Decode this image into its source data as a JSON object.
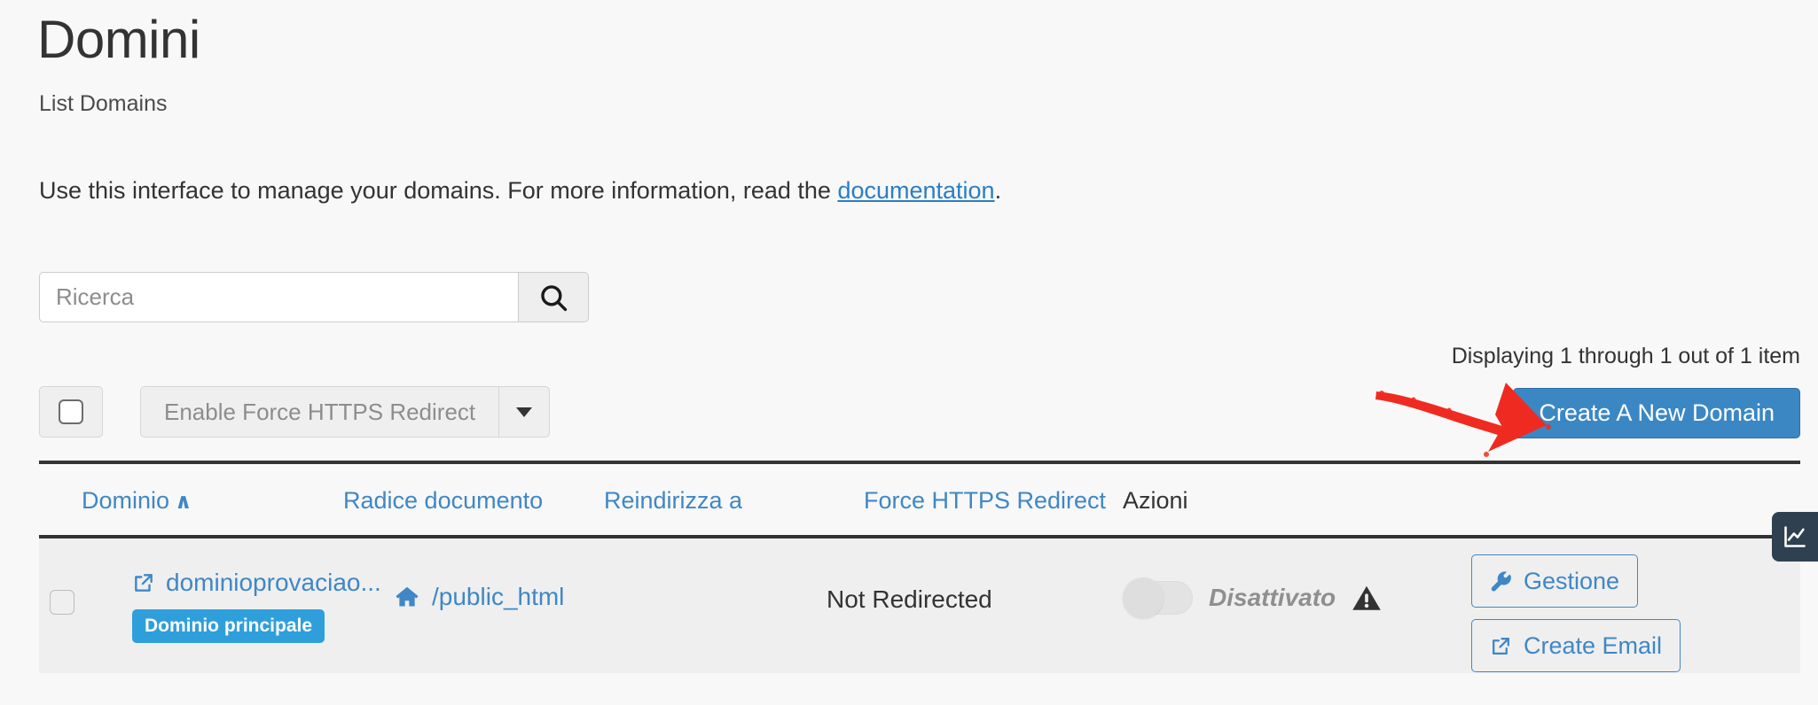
{
  "header": {
    "title": "Domini",
    "subtitle": "List Domains",
    "intro_prefix": "Use this interface to manage your domains. For more information, read the ",
    "intro_link": "documentation",
    "intro_suffix": "."
  },
  "search": {
    "placeholder": "Ricerca",
    "value": "",
    "icon": "search-icon"
  },
  "pagination": {
    "displaying": "Displaying 1 through 1 out of 1 item"
  },
  "toolbar": {
    "select_all_checked": false,
    "bulk_action_label": "Enable Force HTTPS Redirect",
    "caret_icon": "chevron-down-icon",
    "create_button": "Create A New Domain",
    "create_button_color": "#3b87c4"
  },
  "annotation": {
    "arrow_color": "#ef2b21",
    "arrow_name": "red-arrow-annotation"
  },
  "table": {
    "columns": [
      {
        "label": "Dominio",
        "sortable": true,
        "sorted": "asc",
        "sort_glyph": "∧"
      },
      {
        "label": "Radice documento",
        "sortable": true
      },
      {
        "label": "Reindirizza a",
        "sortable": true
      },
      {
        "label": "Force HTTPS Redirect",
        "sortable": true
      },
      {
        "label": "Azioni",
        "sortable": false
      }
    ],
    "rows": [
      {
        "checked": false,
        "domain": "dominioprovaciao...",
        "domain_icon": "external-link-icon",
        "badge": "Dominio principale",
        "badge_color": "#2f9fdc",
        "document_root": "/public_html",
        "document_root_icon": "home-icon",
        "redirects_to": "Not Redirected",
        "https_toggle_on": false,
        "https_status": "Disattivato",
        "https_warning_icon": "warning-triangle-icon",
        "actions": [
          {
            "label": "Gestione",
            "icon": "wrench-icon"
          },
          {
            "label": "Create Email",
            "icon": "external-link-icon"
          }
        ]
      }
    ]
  },
  "side_tab": {
    "icon": "analytics-chart-icon"
  }
}
